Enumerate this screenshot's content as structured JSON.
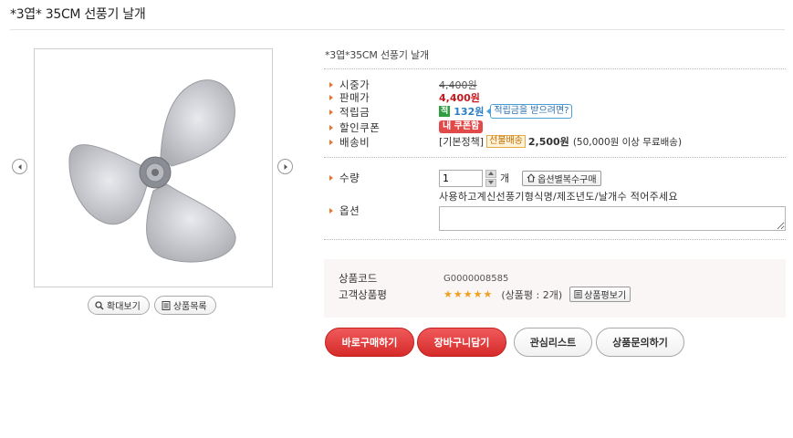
{
  "page_title": "*3엽* 35CM 선풍기 날개",
  "image_buttons": {
    "zoom_label": "확대보기",
    "list_label": "상품목록"
  },
  "product": {
    "name": "*3엽*35CM 선풍기 날개",
    "rows": {
      "list_price_label": "시중가",
      "list_price": "4,400원",
      "sale_price_label": "판매가",
      "sale_price": "4,400원",
      "points_label": "적립금",
      "points_badge": "적",
      "points": "132원",
      "points_tip": "적립금을 받으려면?",
      "coupon_label": "할인쿠폰",
      "coupon_badge": "내 쿠폰함",
      "shipping_label": "배송비",
      "shipping_policy": "[기본정책]",
      "shipping_badge": "선불배송",
      "shipping_fee": "2,500원",
      "shipping_note": "(50,000원 이상 무료배송)"
    },
    "quantity": {
      "label": "수량",
      "value": "1",
      "unit": "개",
      "multi_option_button": "옵션별복수구매"
    },
    "option": {
      "label": "옵션",
      "note": "사용하고계신선풍기형식명/제조년도/날개수 적어주세요",
      "value": ""
    },
    "code": {
      "code_label": "상품코드",
      "code_value": "G0000008585",
      "review_label": "고객상품평",
      "rating": 5,
      "review_count": "(상품평 : 2개)",
      "review_button": "상품평보기"
    }
  },
  "actions": {
    "buy_now": "바로구매하기",
    "add_cart": "장바구니담기",
    "wishlist": "관심리스트",
    "inquiry": "상품문의하기"
  },
  "colors": {
    "accent_red": "#d62a2a",
    "price_red": "#c8171d",
    "points_blue": "#2c7ec4",
    "bullet_orange": "#e8762a"
  }
}
